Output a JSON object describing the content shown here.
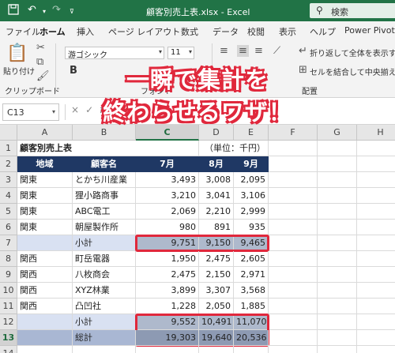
{
  "titlebar": {
    "save_icon": "save-icon",
    "undo_icon": "undo-icon",
    "redo_icon": "redo-icon",
    "title": "顧客別売上表.xlsx  -  Excel",
    "search_label": "検索",
    "bg": "#217346"
  },
  "menu": {
    "tabs": [
      "ファイル",
      "ホーム",
      "挿入",
      "ページ レイアウト",
      "数式",
      "データ",
      "校閲",
      "表示",
      "ヘルプ",
      "Power Pivot"
    ],
    "active": "ホーム"
  },
  "ribbon": {
    "paste_label": "貼り付け",
    "clipboard_group": "クリップボード",
    "font_group": "フォント",
    "align_group": "配置",
    "font_name": "游ゴシック",
    "font_size": "11",
    "bold": "B",
    "wrap_text": "折り返して全体を表示する",
    "merge_center": "セルを結合して中央揃え"
  },
  "formula_bar": {
    "name_box": "C13",
    "cancel": "×",
    "enter": "✓",
    "fx": "fx"
  },
  "overlay": {
    "line1": "一瞬で集計を",
    "line2": "終わらせるワザ！",
    "color": "#e0283c"
  },
  "sheet": {
    "columns": [
      "A",
      "B",
      "C",
      "D",
      "E",
      "F",
      "G",
      "H"
    ],
    "selected_column": "C",
    "selected_row": "13",
    "title": "顧客別売上表",
    "unit": "（単位：千円）",
    "headers": [
      "地域",
      "顧客名",
      "7月",
      "8月",
      "9月"
    ],
    "rows": [
      {
        "num": "3",
        "region": "関東",
        "customer": "とかち川産業",
        "jul": "3,493",
        "aug": "3,008",
        "sep": "2,095",
        "kind": "data"
      },
      {
        "num": "4",
        "region": "関東",
        "customer": "狸小路商事",
        "jul": "3,210",
        "aug": "3,041",
        "sep": "3,106",
        "kind": "data"
      },
      {
        "num": "5",
        "region": "関東",
        "customer": "ABC電工",
        "jul": "2,069",
        "aug": "2,210",
        "sep": "2,999",
        "kind": "data"
      },
      {
        "num": "6",
        "region": "関東",
        "customer": "朝屋製作所",
        "jul": "980",
        "aug": "891",
        "sep": "935",
        "kind": "data"
      },
      {
        "num": "7",
        "region": "",
        "customer": "小計",
        "jul": "9,751",
        "aug": "9,150",
        "sep": "9,465",
        "kind": "sub"
      },
      {
        "num": "8",
        "region": "関西",
        "customer": "町岳電器",
        "jul": "1,950",
        "aug": "2,475",
        "sep": "2,605",
        "kind": "data"
      },
      {
        "num": "9",
        "region": "関西",
        "customer": "八枚商会",
        "jul": "2,475",
        "aug": "2,150",
        "sep": "2,971",
        "kind": "data"
      },
      {
        "num": "10",
        "region": "関西",
        "customer": "XYZ林業",
        "jul": "3,899",
        "aug": "3,307",
        "sep": "3,568",
        "kind": "data"
      },
      {
        "num": "11",
        "region": "関西",
        "customer": "凸凹社",
        "jul": "1,228",
        "aug": "2,050",
        "sep": "1,885",
        "kind": "data"
      },
      {
        "num": "12",
        "region": "",
        "customer": "小計",
        "jul": "9,552",
        "aug": "10,491",
        "sep": "11,070",
        "kind": "sub"
      },
      {
        "num": "13",
        "region": "",
        "customer": "総計",
        "jul": "19,303",
        "aug": "19,640",
        "sep": "20,536",
        "kind": "tot"
      },
      {
        "num": "14",
        "region": "",
        "customer": "",
        "jul": "",
        "aug": "",
        "sep": "",
        "kind": "empty"
      }
    ]
  }
}
